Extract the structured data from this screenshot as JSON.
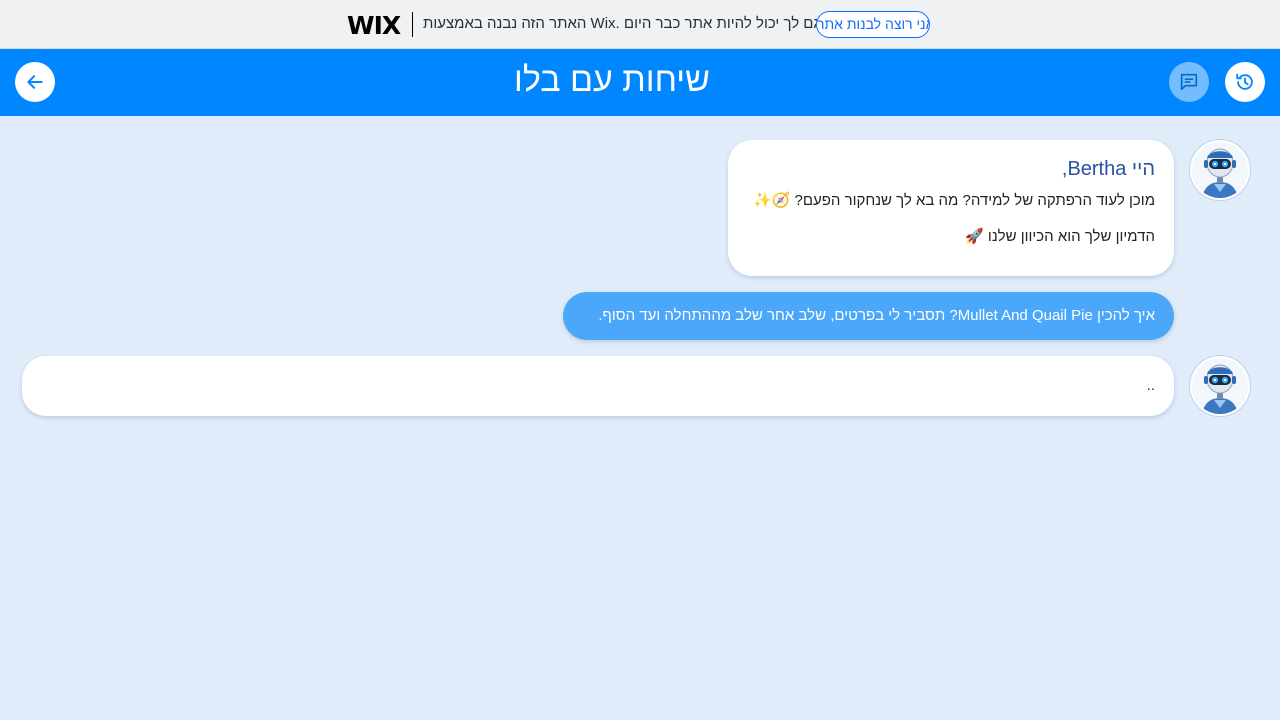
{
  "wix_banner": {
    "logo": "WIX",
    "message": "האתר הזה נבנה באמצעות Wix. גם לך יכול להיות אתר כבר היום.",
    "cta_label": "אני רוצה לבנות אתר"
  },
  "header": {
    "title": "שיחות עם בלו",
    "back_icon": "arrow-left-icon",
    "chat_icon": "chat-bubble-icon",
    "history_icon": "history-icon",
    "accent_color": "#0087ff"
  },
  "messages": [
    {
      "sender": "bot",
      "greeting": "היי Bertha,",
      "lines": [
        {
          "text": "מוכן לעוד הרפתקה של למידה? מה בא לך שנחקור הפעם?",
          "emoji": "🧭✨"
        },
        {
          "text": "הדמיון שלך הוא הכיוון שלנו",
          "emoji": "🚀"
        }
      ]
    },
    {
      "sender": "user",
      "text": "איך להכין Mullet And Quail Pie? תסביר לי בפרטים, שלב אחר שלב מההתחלה ועד הסוף."
    },
    {
      "sender": "bot",
      "text": ".."
    }
  ],
  "colors": {
    "background": "#e0ecfa",
    "user_bubble": "#4aa7f9",
    "bot_bubble": "#ffffff",
    "greeting_text": "#2a4fa3"
  }
}
